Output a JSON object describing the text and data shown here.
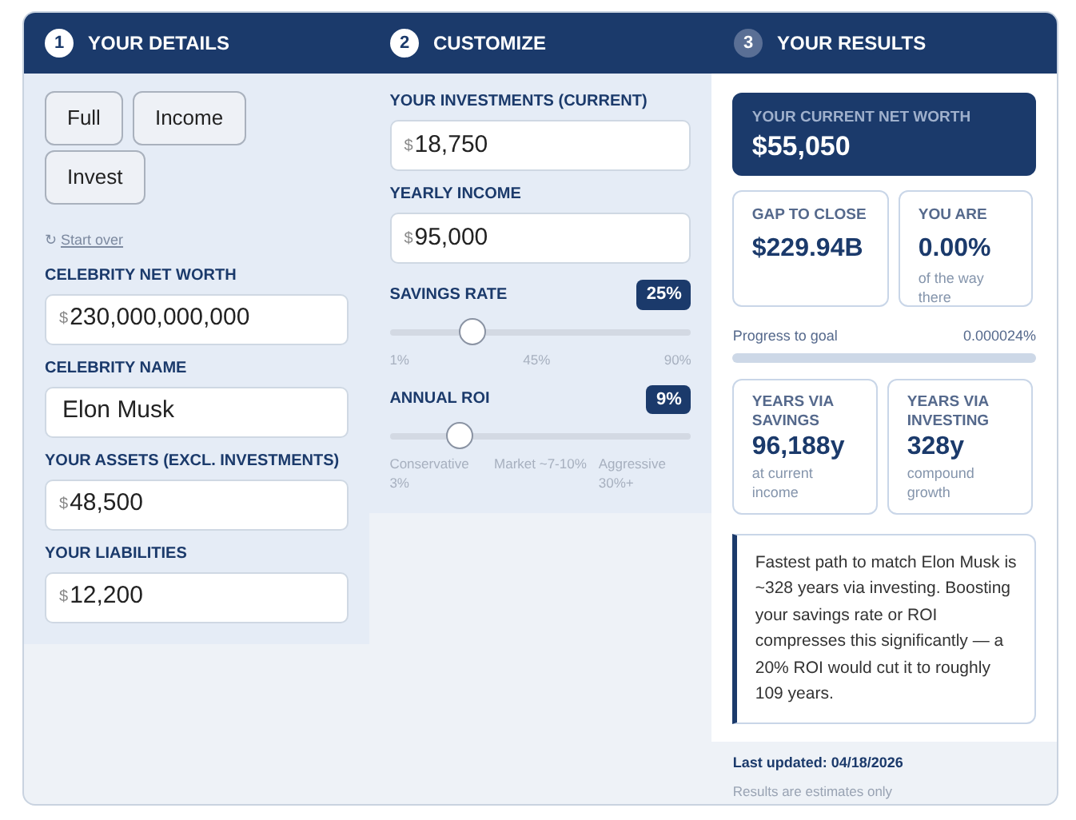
{
  "steps": [
    {
      "number": "1",
      "title": "YOUR DETAILS",
      "completed": true
    },
    {
      "number": "2",
      "title": "CUSTOMIZE",
      "completed": true
    },
    {
      "number": "3",
      "title": "YOUR RESULTS",
      "completed": false
    }
  ],
  "details": {
    "presets": [
      {
        "label": "Full"
      },
      {
        "label": "Income"
      },
      {
        "label": "Invest"
      }
    ],
    "start_over": {
      "icon": "↻",
      "label": "Start over"
    },
    "fields": [
      {
        "label": "CELEBRITY NET WORTH",
        "prefix": "$",
        "value": "230,000,000,000"
      },
      {
        "label": "CELEBRITY NAME",
        "value": "Elon Musk"
      },
      {
        "label": "YOUR ASSETS (EXCL. INVESTMENTS)",
        "prefix": "$",
        "value": "48,500"
      },
      {
        "label": "YOUR LIABILITIES",
        "prefix": "$",
        "value": "12,200"
      }
    ]
  },
  "customize": {
    "fields": [
      {
        "label": "YOUR INVESTMENTS (CURRENT)",
        "prefix": "$",
        "value": "18,750"
      },
      {
        "label": "YEARLY INCOME",
        "prefix": "$",
        "value": "95,000"
      }
    ],
    "sliders": [
      {
        "label": "SAVINGS RATE",
        "reading": "25%",
        "level": 0.27,
        "ticks": [
          "1%",
          "45%",
          "90%"
        ]
      },
      {
        "label": "ANNUAL ROI",
        "reading": "9%",
        "level": 0.23,
        "ticks": [
          "Conservative 3%",
          "Market ~7-10%",
          "Aggressive 30%+"
        ]
      }
    ]
  },
  "results": {
    "net_worth": {
      "label": "YOUR CURRENT NET WORTH",
      "value": "$55,050"
    },
    "stats": [
      {
        "label": "GAP TO CLOSE",
        "value": "$229.94B"
      },
      {
        "label": "YOU ARE",
        "value": "0.00%",
        "note": "of the way there"
      }
    ],
    "progress": {
      "label": "Progress to goal",
      "reading": "0.000024%"
    },
    "years": [
      {
        "label": "YEARS VIA SAVINGS",
        "value": "96,188y",
        "note": "at current income"
      },
      {
        "label": "YEARS VIA INVESTING",
        "value": "328y",
        "note": "compound growth"
      }
    ],
    "insight": "Fastest path to match Elon Musk is ~328 years via investing. Boosting your savings rate or ROI compresses this significantly — a 20% ROI would cut it to roughly 109 years.",
    "last_updated": "Last updated: 04/18/2026",
    "disclaimer": "Results are estimates only"
  }
}
